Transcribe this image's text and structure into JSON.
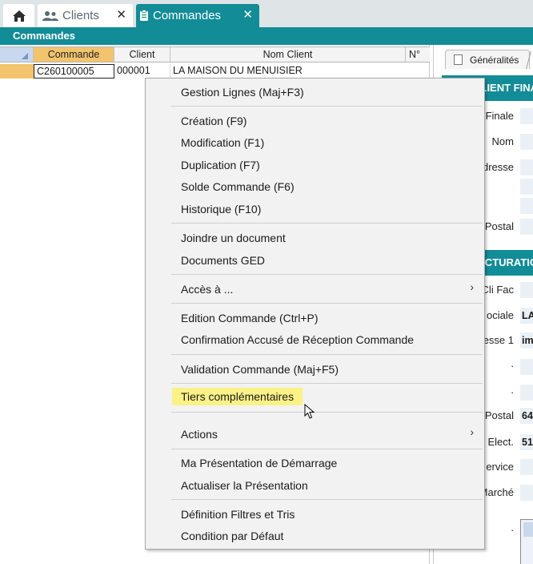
{
  "tabs": {
    "home_icon": "home-icon",
    "clients_label": "Clients",
    "commandes_label": "Commandes",
    "close_glyph": "✕"
  },
  "titlebar": {
    "title": "Commandes"
  },
  "grid": {
    "columns": [
      "Commande",
      "Client",
      "Nom Client",
      "N°"
    ],
    "rows": [
      {
        "commande": "C260100005",
        "client": "000001",
        "nom_client": "LA MAISON DU MENUISIER"
      }
    ]
  },
  "right_panel": {
    "tab_label": "Généralités",
    "section1": "CLIENT FINA",
    "labels1": [
      "Finale",
      "Nom",
      "dresse",
      "Postal"
    ],
    "section2": "FACTURATIO",
    "labels2": [
      "Cli Fac",
      "ociale",
      "esse 1",
      ".",
      ".",
      "Postal",
      "Elect.",
      "ervice",
      "Marché",
      "."
    ],
    "values2": {
      "sociale": "LA",
      "adresse1": "im",
      "postal": "64",
      "elect": "51"
    }
  },
  "context_menu": {
    "items": [
      "Gestion Lignes (Maj+F3)",
      "Création (F9)",
      "Modification (F1)",
      "Duplication (F7)",
      "Solde Commande (F6)",
      "Historique (F10)",
      "Joindre un document",
      "Documents GED",
      "Accès à ...",
      "Edition Commande (Ctrl+P)",
      "Confirmation Accusé de Réception Commande",
      "Validation Commande (Maj+F5)",
      "Tiers complémentaires",
      "Actions",
      "Ma Présentation de Démarrage",
      "Actualiser la Présentation",
      "Définition Filtres et Tris",
      "Condition par Défaut"
    ],
    "submenu_arrow": "›",
    "highlight_color": "#fbf287"
  },
  "colors": {
    "accent": "#128c97",
    "selected_header": "#f2c46d"
  }
}
